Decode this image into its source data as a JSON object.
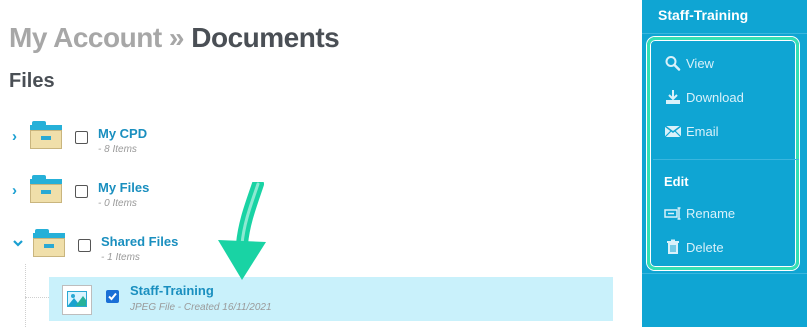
{
  "breadcrumb": {
    "parent": "My Account",
    "separator": "»",
    "current": "Documents"
  },
  "section_title": "Files",
  "tree": [
    {
      "name": "My CPD",
      "meta": "- 8 Items",
      "expanded": false,
      "checked": false
    },
    {
      "name": "My Files",
      "meta": "- 0 Items",
      "expanded": false,
      "checked": false
    },
    {
      "name": "Shared Files",
      "meta": "- 1 Items",
      "expanded": true,
      "checked": false
    }
  ],
  "selected_file": {
    "name": "Staff-Training",
    "meta": "JPEG File - Created 16/11/2021",
    "checked": true,
    "icon": "image-file-icon"
  },
  "panel": {
    "title": "Staff-Training",
    "actions": [
      {
        "label": "View",
        "icon": "magnifier-icon"
      },
      {
        "label": "Download",
        "icon": "download-icon"
      },
      {
        "label": "Email",
        "icon": "envelope-icon"
      }
    ],
    "edit_heading": "Edit",
    "edit_actions": [
      {
        "label": "Rename",
        "icon": "rename-icon"
      },
      {
        "label": "Delete",
        "icon": "trash-icon"
      }
    ]
  },
  "colors": {
    "panel_bg": "#0fa5d3",
    "highlight_border": "#34e0b4",
    "selected_row_bg": "#c9f1fb",
    "link": "#1a8fbf",
    "arrow": "#19d3a4"
  }
}
